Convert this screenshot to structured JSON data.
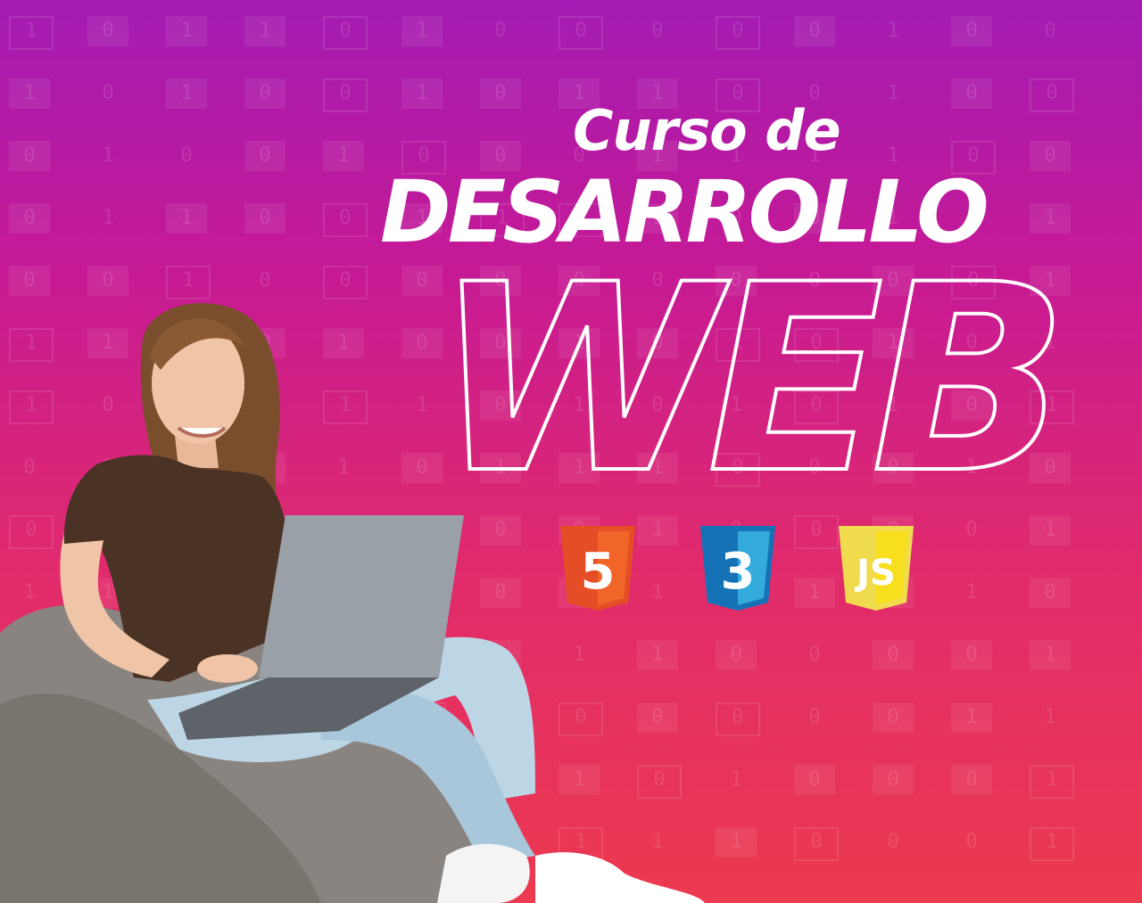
{
  "headline": {
    "line1": "Curso de",
    "line2": "DESARROLLO",
    "line3": "WEB"
  },
  "badges": [
    {
      "name": "html5",
      "text": "5",
      "color": "#e44d26",
      "shade": "#f16529"
    },
    {
      "name": "css3",
      "text": "3",
      "color": "#1572b6",
      "shade": "#33a9dc"
    },
    {
      "name": "javascript",
      "text": "JS",
      "color": "#f0db4f",
      "shade": "#f7df1e"
    }
  ],
  "colors": {
    "gradient_top": "#a31bb3",
    "gradient_bottom": "#ec3a4f",
    "text": "#ffffff",
    "shirt": "#4a3324",
    "jeans": "#bcd6e6",
    "beanbag": "#8a8480",
    "laptop": "#9aa0a8"
  }
}
